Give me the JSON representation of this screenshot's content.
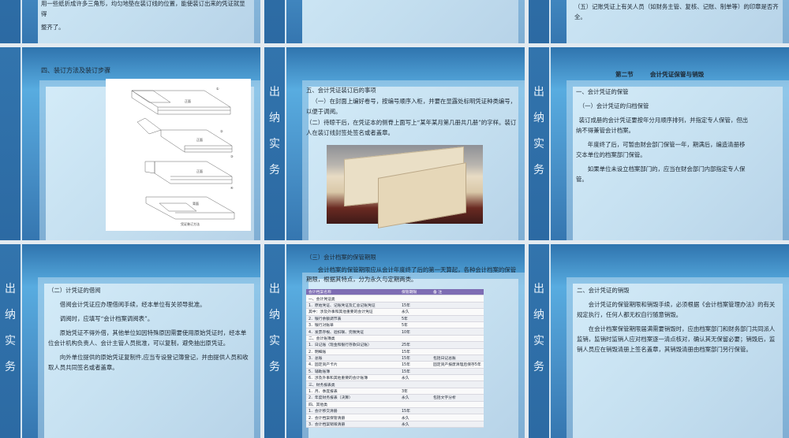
{
  "side_title": [
    "出",
    "纳",
    "实",
    "务"
  ],
  "slides": {
    "s1": {
      "text": "用一些纸折成许多三角形，均匀地垫在装订线的位置，能使装订出来的凭证就显得",
      "text2": "整齐了。"
    },
    "s3": {
      "text": "（五）记账凭证上有关人员（如财务主管、复核、记账、制单等）的印章是否齐全。"
    },
    "s4": {
      "title": "四、装订方法及装订步骤",
      "labels": [
        "正面",
        "正面",
        "正面",
        "背面",
        "凭证装订方法",
        "①",
        "②",
        "③",
        "④"
      ]
    },
    "s5": {
      "title": "五、会计凭证装订后的事项",
      "p1": "（一）在封面上编好卷号，按编号顺序入柜，并要在显露处标明凭证种类编号，以便于调阅。",
      "p2": "（二）待晾干后，在凭证本的侧脊上面写上“某年某月第几册共几册”的字样。装订人在装订线封签处签名或者盖章。"
    },
    "s6": {
      "heading": "第二节        会计凭证保管与销毁",
      "h1": "一、会计凭证的保管",
      "h2": "（一）会计凭证的归档保管",
      "p1": "装订成册的会计凭证要按年分月顺序排列，并指定专人保管，但出纳不得兼管会计档案。",
      "p2": "年度终了后，可暂由财会部门保管一年，期满后，编造清册移交本单位的档案部门保管。",
      "p3": "如果单位未设立档案部门的，应当在财会部门内部指定专人保管。"
    },
    "s7": {
      "h": "（二）计凭证的借阅",
      "p1": "借阅会计凭证应办理借阅手续，经本单位有关领导批准。",
      "p2": "调阅时，应填写“会计档案调阅表”。",
      "p3": "原始凭证不得外借，其他单位如因特殊原因需要使用原始凭证时，经本单位会计机构负责人、会计主管人员批准，可以复制，避免抽出原凭证。",
      "p4": "向外单位提供的原始凭证复制件,应当专设登记簿登记，并由提供人员和收取人员共同签名或者盖章。"
    },
    "s8": {
      "h": "（三）会计档案的保管期限",
      "p1": "会计档案的保管期限应从会计年度终了后的第一天算起，各种会计档案的保管期限，根据其特点，分为永久与定期两类。",
      "table": {
        "headers": [
          "会计档案名称",
          "保管期限",
          "备  注"
        ],
        "rows": [
          [
            "一、会计凭证类",
            "",
            ""
          ],
          [
            "1．原始凭证、记账凭证及汇总记账凭证",
            "15年",
            ""
          ],
          [
            "其中：涉及外事和其他重要的会计凭证",
            "永久",
            ""
          ],
          [
            "2．银行余额调节表",
            "5年",
            ""
          ],
          [
            "3．银行对账单",
            "5年",
            ""
          ],
          [
            "4．发票存根、验扣联、完税凭证",
            "10年",
            ""
          ],
          [
            "二、会计账簿类",
            "",
            ""
          ],
          [
            "1．日记账（现金和银行存款日记账）",
            "25年",
            ""
          ],
          [
            "2．明细账",
            "15年",
            ""
          ],
          [
            "3．总账",
            "15年",
            "包括日记总账"
          ],
          [
            "4．固定资产卡片",
            "15年",
            "固定资产报废清理后保存5年"
          ],
          [
            "5．辅助账簿",
            "15年",
            ""
          ],
          [
            "6．涉及外事和其他重要的会计账簿",
            "永久",
            ""
          ],
          [
            "三、财务报表类",
            "",
            ""
          ],
          [
            "1．月、季度报表",
            "3年",
            ""
          ],
          [
            "2．年度财务报表（决算）",
            "永久",
            "包括文字分析"
          ],
          [
            "四、其他类",
            "",
            ""
          ],
          [
            "1．会计移交清册",
            "15年",
            ""
          ],
          [
            "2．会计档案保管清册",
            "永久",
            ""
          ],
          [
            "3．会计档案销毁清册",
            "永久",
            ""
          ]
        ]
      }
    },
    "s9": {
      "h": "二、会计凭证的销毁",
      "p1": "会计凭证的保管期限和销毁手续，必须根据《会计档案管理办法》的有关规定执行，任何人都无权自行随意销毁。",
      "p2": "在会计档案保管期限届满需要销毁时，应由档案部门和财务部门共同派人监销，监销时监销人应对档案逐一清点核对，确认其无保留必要；销毁后，监销人员应在销毁清册上签名盖章，其销毁清册由档案部门另行保管。"
    }
  }
}
